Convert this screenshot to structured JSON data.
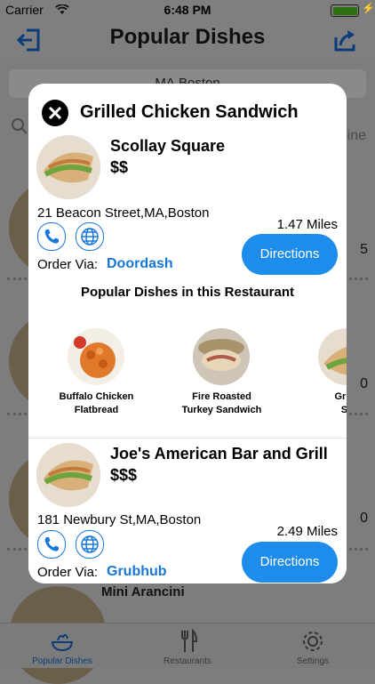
{
  "status_bar": {
    "carrier": "Carrier",
    "time": "6:48 PM"
  },
  "nav": {
    "title": "Popular Dishes"
  },
  "background": {
    "location": "MA,Boston",
    "partial_text": "ine",
    "rows": [
      {
        "count": "5"
      },
      {
        "count": "0"
      },
      {
        "count": "0"
      }
    ],
    "last_item": "Mini Arancini"
  },
  "modal": {
    "title": "Grilled Chicken Sandwich",
    "restaurants": [
      {
        "name": "Scollay Square",
        "price": "$$",
        "address": "21 Beacon Street,MA,Boston",
        "miles": "1.47 Miles",
        "order_label": "Order Via:",
        "order_service": "Doordash",
        "directions": "Directions"
      },
      {
        "name": "Joe's American Bar and Grill",
        "price": "$$$",
        "address": "181 Newbury St,MA,Boston",
        "miles": "2.49 Miles",
        "order_label": "Order Via:",
        "order_service": "Grubhub",
        "directions": "Directions"
      }
    ],
    "popular_title": "Popular Dishes in this Restaurant",
    "dishes": [
      {
        "line1": "Buffalo Chicken",
        "line2": "Flatbread"
      },
      {
        "line1": "Fire Roasted",
        "line2": "Turkey Sandwich"
      },
      {
        "line1": "Grille",
        "line2": "Sa"
      }
    ]
  },
  "tabs": [
    {
      "label": "Popular Dishes",
      "active": true
    },
    {
      "label": "Restaurants",
      "active": false
    },
    {
      "label": "Settings",
      "active": false
    }
  ],
  "colors": {
    "accent": "#1d8ceb",
    "link": "#1877d8"
  }
}
